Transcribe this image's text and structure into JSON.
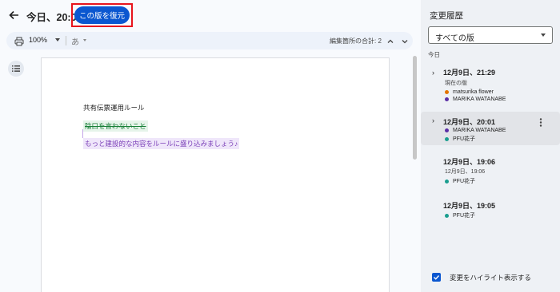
{
  "header": {
    "title": "今日、20:01",
    "restore_label": "この版を復元"
  },
  "toolbar": {
    "zoom": "100%",
    "ime": "あ",
    "edit_count": "編集箇所の合計: 2"
  },
  "document": {
    "title": "共有伝票運用ルール",
    "deleted_line": "陰口を言わないこと",
    "added_line": "もっと建設的な内容をルールに盛り込みましょう♪"
  },
  "history_panel": {
    "title": "変更履歴",
    "filter": "すべての版",
    "group_label": "今日",
    "versions": [
      {
        "date": "12月9日、21:29",
        "subtitle": "現在の版",
        "expandable": true,
        "users": [
          {
            "name": "matsurika flower",
            "color": "#e37400"
          },
          {
            "name": "MARIKA WATANABE",
            "color": "#5b2ea6"
          }
        ]
      },
      {
        "date": "12月9日、20:01",
        "subtitle": "",
        "expandable": true,
        "selected": true,
        "users": [
          {
            "name": "MARIKA WATANABE",
            "color": "#5b2ea6"
          },
          {
            "name": "PFU花子",
            "color": "#1a9e8f"
          }
        ]
      },
      {
        "date": "12月9日、19:06",
        "subtitle": "12月9日、19:06",
        "expandable": false,
        "users": [
          {
            "name": "PFU花子",
            "color": "#1a9e8f"
          }
        ]
      },
      {
        "date": "12月9日、19:05",
        "subtitle": "",
        "expandable": false,
        "users": [
          {
            "name": "PFU花子",
            "color": "#1a9e8f"
          }
        ]
      }
    ],
    "highlight_label": "変更をハイライト表示する",
    "highlight_checked": true
  },
  "colors": {
    "accent": "#0b57d0",
    "annotation_box": "#e8141c",
    "deleted_text": "#188038",
    "added_text": "#7b3fb8"
  }
}
